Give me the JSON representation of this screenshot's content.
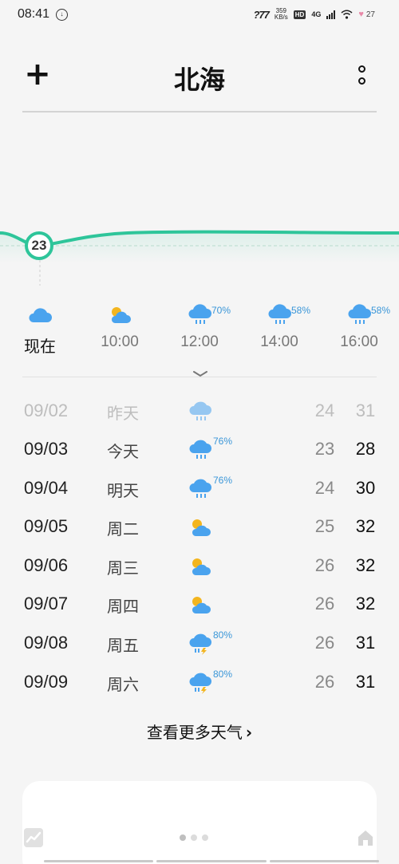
{
  "status_bar": {
    "time": "08:41",
    "notif_icon": "notification-badge-icon",
    "carrier_logo": "?77",
    "net_speed_value": "359",
    "net_speed_unit": "KB/s",
    "hd": "HD",
    "network": "4G",
    "battery": "27"
  },
  "header": {
    "add_label": "+",
    "city": "北海"
  },
  "current_temp": "23",
  "hourly": [
    {
      "time": "现在",
      "icon": "cloudy-icon",
      "precip": ""
    },
    {
      "time": "10:00",
      "icon": "partly-cloudy-icon",
      "precip": ""
    },
    {
      "time": "12:00",
      "icon": "rain-icon",
      "precip": "70%"
    },
    {
      "time": "14:00",
      "icon": "rain-icon",
      "precip": "58%"
    },
    {
      "time": "16:00",
      "icon": "rain-icon",
      "precip": "58%"
    }
  ],
  "daily": [
    {
      "date": "09/02",
      "day": "昨天",
      "icon": "rain-icon",
      "precip": "",
      "low": "24",
      "high": "31",
      "past": true
    },
    {
      "date": "09/03",
      "day": "今天",
      "icon": "rain-icon",
      "precip": "76%",
      "low": "23",
      "high": "28"
    },
    {
      "date": "09/04",
      "day": "明天",
      "icon": "rain-icon",
      "precip": "76%",
      "low": "24",
      "high": "30"
    },
    {
      "date": "09/05",
      "day": "周二",
      "icon": "partly-cloudy-icon",
      "precip": "",
      "low": "25",
      "high": "32"
    },
    {
      "date": "09/06",
      "day": "周三",
      "icon": "partly-cloudy-icon",
      "precip": "",
      "low": "26",
      "high": "32"
    },
    {
      "date": "09/07",
      "day": "周四",
      "icon": "partly-cloudy-icon",
      "precip": "",
      "low": "26",
      "high": "32"
    },
    {
      "date": "09/08",
      "day": "周五",
      "icon": "thunderstorm-icon",
      "precip": "80%",
      "low": "26",
      "high": "31"
    },
    {
      "date": "09/09",
      "day": "周六",
      "icon": "thunderstorm-icon",
      "precip": "80%",
      "low": "26",
      "high": "31"
    }
  ],
  "more_weather": "查看更多天气",
  "more_weather_arrow": "›",
  "colors": {
    "accent_green": "#2ec59a",
    "rain_blue": "#3a96d8",
    "sun_yellow": "#f3b51e"
  }
}
